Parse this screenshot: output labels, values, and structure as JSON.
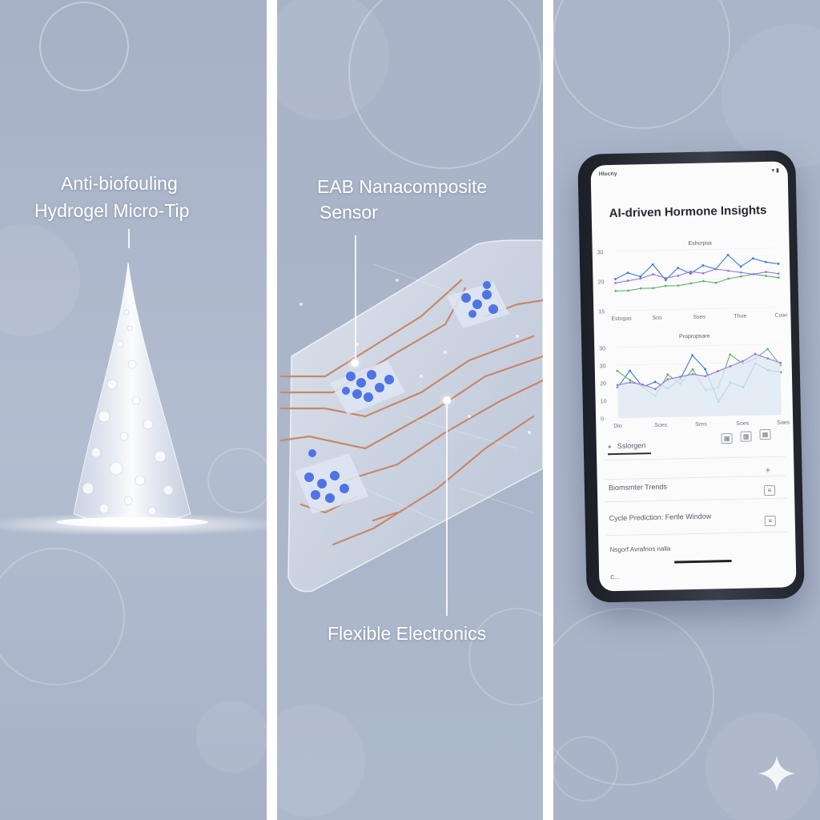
{
  "panels": {
    "left": {
      "title_line1": "Anti-biofouling",
      "title_line2": "Hydrogel Micro-Tip"
    },
    "middle": {
      "title_line1": "EAB Nanacomposite",
      "title_line2": "Sensor",
      "bottom_label": "Flexible Electronics"
    },
    "right": {
      "status_left": "Hlecny",
      "app_title": "AI-driven Hormone Insights",
      "chart1_title": "Eshcrpsa",
      "chart1_yticks": [
        "30",
        "20",
        "15"
      ],
      "chart1_xticks": [
        "Estogas",
        "Sos",
        "Sses",
        "Thoe",
        "Cows"
      ],
      "chart2_title": "Propropsare",
      "chart2_yticks": [
        "30",
        "30",
        "20",
        "10",
        "0"
      ],
      "chart2_xticks": [
        "Dio",
        "Soes",
        "Sres",
        "Soes",
        "Saes"
      ],
      "tab_label": "Sslorgen",
      "list_item1": "Biomsmter Trends",
      "list_item2": "Cycle Prediction: Fertle Window",
      "list_item3": "Nsgorf Avrafnos nalla",
      "list_item4": "C..."
    }
  },
  "colors": {
    "background": "#a9b4c9",
    "trace": "#c8876a",
    "molecule": "#4e74e6",
    "chart_blue": "#3a7ed6",
    "chart_green": "#62b46c",
    "chart_purple": "#9a78d8"
  },
  "icons": [
    "sparkle-icon",
    "calendar-icon",
    "plus-icon",
    "list-icon"
  ],
  "chart_data": [
    {
      "type": "line",
      "title": "Eshcrpsa",
      "categories": [
        "Estogas",
        "Sos",
        "Sses",
        "Thoe",
        "Cows"
      ],
      "ylim": [
        0,
        30
      ],
      "series": [
        {
          "values": [
            16,
            19,
            17,
            23,
            15,
            21,
            18,
            22,
            20,
            27,
            21,
            25,
            23,
            22
          ]
        },
        {
          "values": [
            10,
            10,
            11,
            11,
            12,
            12,
            13,
            14,
            13,
            15,
            16,
            17,
            16,
            15
          ]
        },
        {
          "values": [
            14,
            15,
            16,
            18,
            16,
            17,
            19,
            18,
            20,
            19,
            18,
            17,
            18,
            17
          ]
        }
      ]
    },
    {
      "type": "area",
      "title": "Propropsare",
      "categories": [
        "Dio",
        "Soes",
        "Sres",
        "Soes",
        "Saes"
      ],
      "ylim": [
        0,
        30
      ],
      "series": [
        {
          "values": [
            13,
            20,
            13,
            15,
            12,
            16,
            26,
            20,
            6,
            14,
            12,
            22,
            19,
            18
          ]
        },
        {
          "values": [
            20,
            16,
            13,
            9,
            18,
            14,
            20,
            11,
            12,
            26,
            22,
            24,
            28,
            21
          ]
        },
        {
          "values": [
            14,
            15,
            14,
            12,
            16,
            17,
            18,
            17,
            19,
            21,
            23,
            26,
            24,
            22
          ]
        }
      ]
    }
  ]
}
